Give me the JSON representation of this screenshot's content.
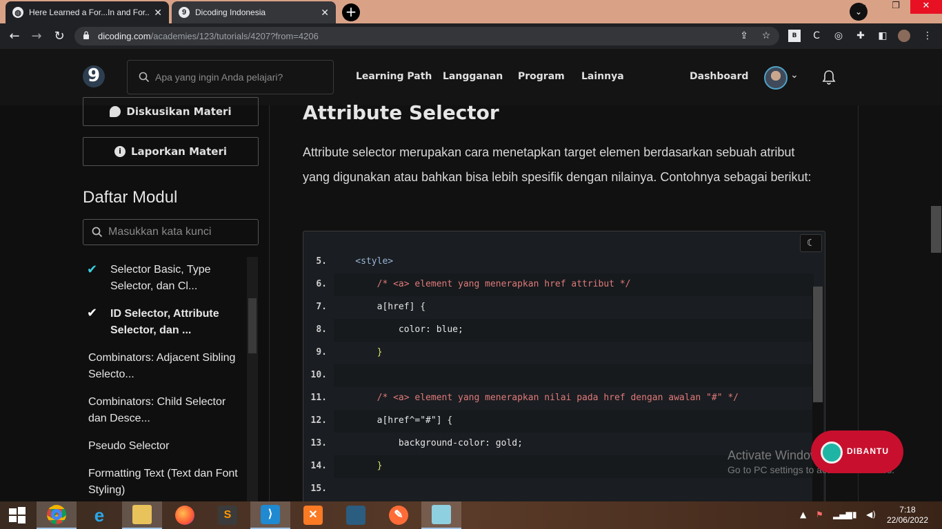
{
  "browser": {
    "tabs": [
      {
        "title": "Here Learned a For...In and For...C",
        "favicon": "globe-icon"
      },
      {
        "title": "Dicoding Indonesia",
        "favicon": "dicoding-logo-icon"
      }
    ],
    "url_domain": "dicoding.com",
    "url_path": "/academies/123/tutorials/4207?from=4206"
  },
  "site": {
    "logo_text": "9",
    "search_placeholder": "Apa yang ingin Anda pelajari?",
    "nav": [
      "Learning Path",
      "Langganan",
      "Program",
      "Lainnya"
    ],
    "dashboard_label": "Dashboard"
  },
  "sidebar": {
    "discuss_label": "Diskusikan Materi",
    "report_label": "Laporkan Materi",
    "modules_title": "Daftar Modul",
    "module_search_placeholder": "Masukkan kata kunci",
    "modules": [
      {
        "label": "Selector Basic, Type Selector, dan Cl...",
        "done": true,
        "active": false
      },
      {
        "label": "ID Selector, Attribute Selector, dan ...",
        "done": true,
        "active": true
      },
      {
        "label": "Combinators: Adjacent Sibling Selecto...",
        "done": false,
        "active": false
      },
      {
        "label": "Combinators: Child Selector dan Desce...",
        "done": false,
        "active": false
      },
      {
        "label": "Pseudo Selector",
        "done": false,
        "active": false
      },
      {
        "label": "Formatting Text (Text dan Font Styling)",
        "done": false,
        "active": false
      }
    ]
  },
  "content": {
    "heading": "Attribute Selector",
    "paragraph": "Attribute selector merupakan cara menetapkan target elemen berdasarkan sebuah atribut yang digunakan atau bahkan bisa lebih spesifik dengan nilainya. Contohnya sebagai berikut:",
    "code_lines": [
      {
        "n": "5.",
        "text": "    <style>"
      },
      {
        "n": "6.",
        "text": "        /* <a> element yang menerapkan href attribut */"
      },
      {
        "n": "7.",
        "text": "        a[href] {"
      },
      {
        "n": "8.",
        "text": "            color: blue;"
      },
      {
        "n": "9.",
        "text": "        }"
      },
      {
        "n": "10.",
        "text": ""
      },
      {
        "n": "11.",
        "text": "        /* <a> element yang menerapkan nilai pada href dengan awalan \"#\" */"
      },
      {
        "n": "12.",
        "text": "        a[href^=\"#\"] {"
      },
      {
        "n": "13.",
        "text": "            background-color: gold;"
      },
      {
        "n": "14.",
        "text": "        }"
      },
      {
        "n": "15.",
        "text": ""
      }
    ]
  },
  "overlay": {
    "dibantu_label": "DIBANTU",
    "activate_line1": "Activate Windows",
    "activate_line2": "Go to PC settings to activate Windows."
  },
  "taskbar": {
    "time": "7:18",
    "date": "22/06/2022"
  },
  "colors": {
    "accent_check": "#3ad0e0",
    "brand_red": "#c8102e"
  }
}
